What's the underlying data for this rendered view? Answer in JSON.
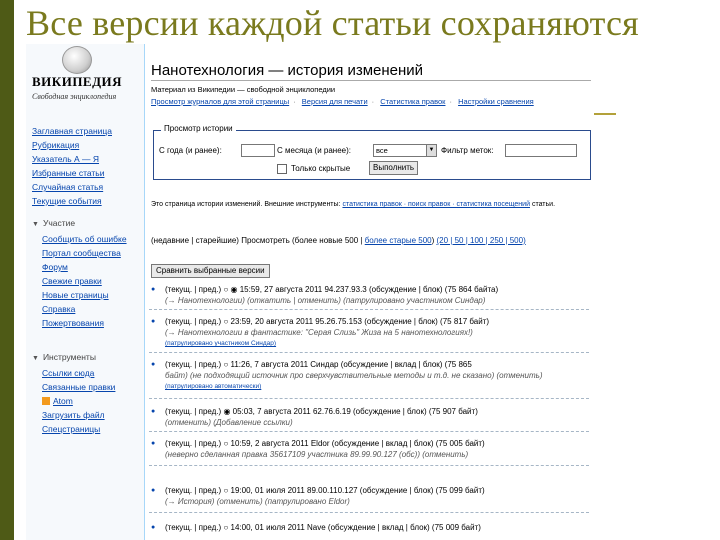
{
  "slide": {
    "title": "Все версии каждой статьи сохраняются"
  },
  "sidebar": {
    "logo_title": "ВИКИПЕДИЯ",
    "logo_subtitle": "Свободная энциклопедия",
    "items": [
      "Заглавная страница",
      "Рубрикация",
      "Указатель А — Я",
      "Избранные статьи",
      "Случайная статья",
      "Текущие события"
    ],
    "participation_heading": "Участие",
    "participation_items": [
      "Сообщить об ошибке",
      "Портал сообщества",
      "Форум",
      "Свежие правки",
      "Новые страницы",
      "Справка",
      "Пожертвования"
    ],
    "tools_heading": "Инструменты",
    "tools_items": [
      "Ссылки сюда",
      "Связанные правки",
      "Atom",
      "Загрузить файл",
      "Спецстраницы"
    ]
  },
  "page": {
    "title": "Нанотехнология — история изменений",
    "subline": "Материал из Википедии — свободной энциклопедии",
    "links": [
      "Просмотр журналов для этой страницы",
      "Версия для печати",
      "Статистика правок",
      "Настройки сравнения"
    ]
  },
  "filter": {
    "legend": "Просмотр истории",
    "from_label": "С года (и ранее):",
    "month_label": "С месяца (и ранее):",
    "month_value": "все",
    "tag_label": "Фильтр меток:",
    "hidden_label": "Только скрытые",
    "submit": "Выполнить"
  },
  "note": {
    "prefix": "Это страница истории изменений. Внешние инструменты:",
    "tools": "статистика правок · поиск правок · статистика посещений",
    "suffix": "статьи."
  },
  "pager": {
    "text": "(недавние | старейшие) Просмотреть (более новые 500 |",
    "older": "более старые 500",
    "nums": "(20 | 50 | 100 | 250 | 500)"
  },
  "compare_button": "Сравнить выбранные версии",
  "revisions": [
    {
      "line1": "(текущ. | пред.) ○ ◉ 15:59, 27 августа 2011 94.237.93.3 (обсуждение | блок) (75 864 байта)",
      "line2": "(→ Нанотехнологии) (откатить | отменить) (патрулировано участником Синдар)"
    },
    {
      "line1": "(текущ. | пред.) ○ 23:59, 20 августа 2011 95.26.75.153 (обсуждение | блок) (75 817 байт)",
      "line2": "(→ Нанотехнологии в фантастике: \"Серая Слизь\" Жиза на 5 нанотехнологиях!)",
      "line3": "(патрулировано участником Синдар)"
    },
    {
      "line1": "(текущ. | пред.) ○ 11:26, 7 августа 2011 Синдар (обсуждение | вклад | блок) (75 865",
      "line2": "байт) (не подходящий источник про сверхчувствительные методы и т.д. не сказано) (отменить)",
      "line3": "(патрулировано автоматически)"
    },
    {
      "line1": "(текущ. | пред.) ◉ 05:03, 7 августа 2011 62.76.6.19 (обсуждение | блок) (75 907 байт)",
      "line2": "(отменить) (Добавление ссылки)"
    },
    {
      "line1": "(текущ. | пред.) ○ 10:59, 2 августа 2011 Eldor (обсуждение | вклад | блок) (75 005 байт)",
      "line2": "(неверно сделанная правка 35617109 участника 89.99.90.127 (обс)) (отменить)"
    },
    {
      "line1": "(текущ. | пред.) ○ 19:00, 01 июля 2011 89.00.110.127 (обсуждение | блок) (75 099 байт)",
      "line2": "(→ История) (отменить) (патрулировано Eldor)"
    },
    {
      "line1": "(текущ. | пред.) ○ 14:00, 01 июля 2011 Nave (обсуждение | вклад | блок) (75 009 байт)"
    }
  ]
}
